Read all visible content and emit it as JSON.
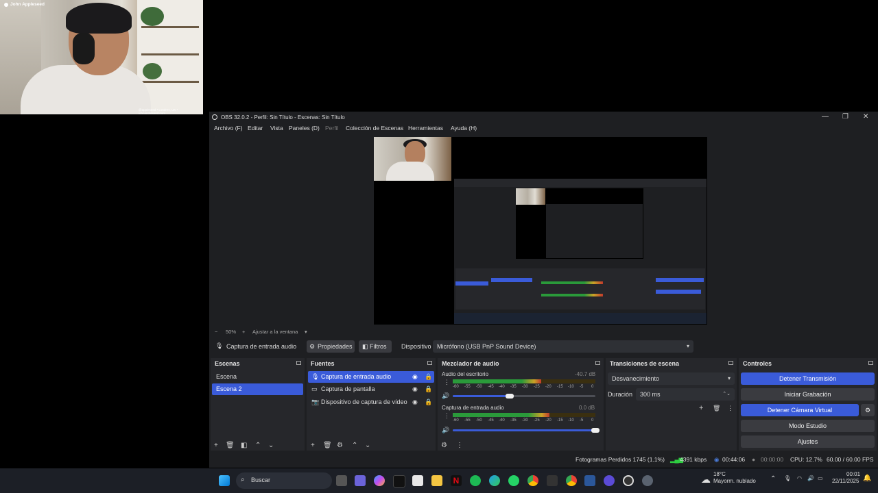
{
  "webcam": {
    "name_tag": "John Appleseed",
    "caption": "@appleseed • Londres, UK • johnappleseed.com"
  },
  "window": {
    "title": "OBS 32.0.2 - Perfil: Sin Título - Escenas: Sin Título",
    "controls": [
      "—",
      "❐",
      "✕"
    ]
  },
  "menu": [
    "Archivo (F)",
    "Editar",
    "Vista",
    "Paneles (D)",
    "Perfil",
    "Colección de Escenas",
    "Herramientas",
    "Ayuda (H)"
  ],
  "zoom": {
    "minus": "−",
    "level": "50%",
    "plus": "+",
    "fit": "Ajustar a la ventana",
    "caret": "▾"
  },
  "source_bar": {
    "source_name": "Captura de entrada audio",
    "properties": "Propiedades",
    "filters": "Filtros",
    "device_label": "Dispositivo",
    "device_value": "Micrófono (USB PnP Sound Device)"
  },
  "scenes": {
    "title": "Escenas",
    "items": [
      "Escena",
      "Escena 2"
    ],
    "selected_index": 1
  },
  "sources": {
    "title": "Fuentes",
    "items": [
      {
        "label": "Captura de entrada audio",
        "icon": "microphone-icon"
      },
      {
        "label": "Captura de pantalla",
        "icon": "monitor-icon"
      },
      {
        "label": "Dispositivo de captura de vídeo",
        "icon": "camera-icon"
      }
    ],
    "selected_index": 0
  },
  "mixer": {
    "title": "Mezclador de audio",
    "channels": [
      {
        "name": "Audio del escritorio",
        "db": "-40.7 dB",
        "level": 0.62,
        "volume": 0.4
      },
      {
        "name": "Captura de entrada audio",
        "db": "0.0 dB",
        "level": 0.68,
        "volume": 1.0
      }
    ],
    "scale": [
      "-60",
      "-55",
      "-50",
      "-45",
      "-40",
      "-35",
      "-30",
      "-25",
      "-20",
      "-15",
      "-10",
      "-5",
      "0"
    ]
  },
  "transitions": {
    "title": "Transiciones de escena",
    "selected": "Desvanecimiento",
    "duration_label": "Duración",
    "duration_value": "300 ms"
  },
  "controls": {
    "title": "Controles",
    "stop_stream": "Detener Transmisión",
    "start_recording": "Iniciar Grabación",
    "stop_virtual_cam": "Detener Cámara Virtual",
    "studio_mode": "Modo Estudio",
    "settings": "Ajustes"
  },
  "status": {
    "dropped_frames": "Fotogramas Perdidos 1745 (1.1%)",
    "bitrate": "4391 kbps",
    "stream_time": "00:44:06",
    "rec_time": "00:00:00",
    "cpu": "CPU: 12.7%",
    "fps": "60.00 / 60.00 FPS"
  },
  "taskbar": {
    "search_placeholder": "Buscar",
    "weather_temp": "18°C",
    "weather_desc": "Mayorm. nublado",
    "time": "00:01",
    "date": "22/11/2025"
  },
  "colors": {
    "accent": "#3a5bd9",
    "meter_green": "#2a9a3a",
    "meter_yellow": "#c9a227",
    "meter_red": "#c0392b"
  }
}
